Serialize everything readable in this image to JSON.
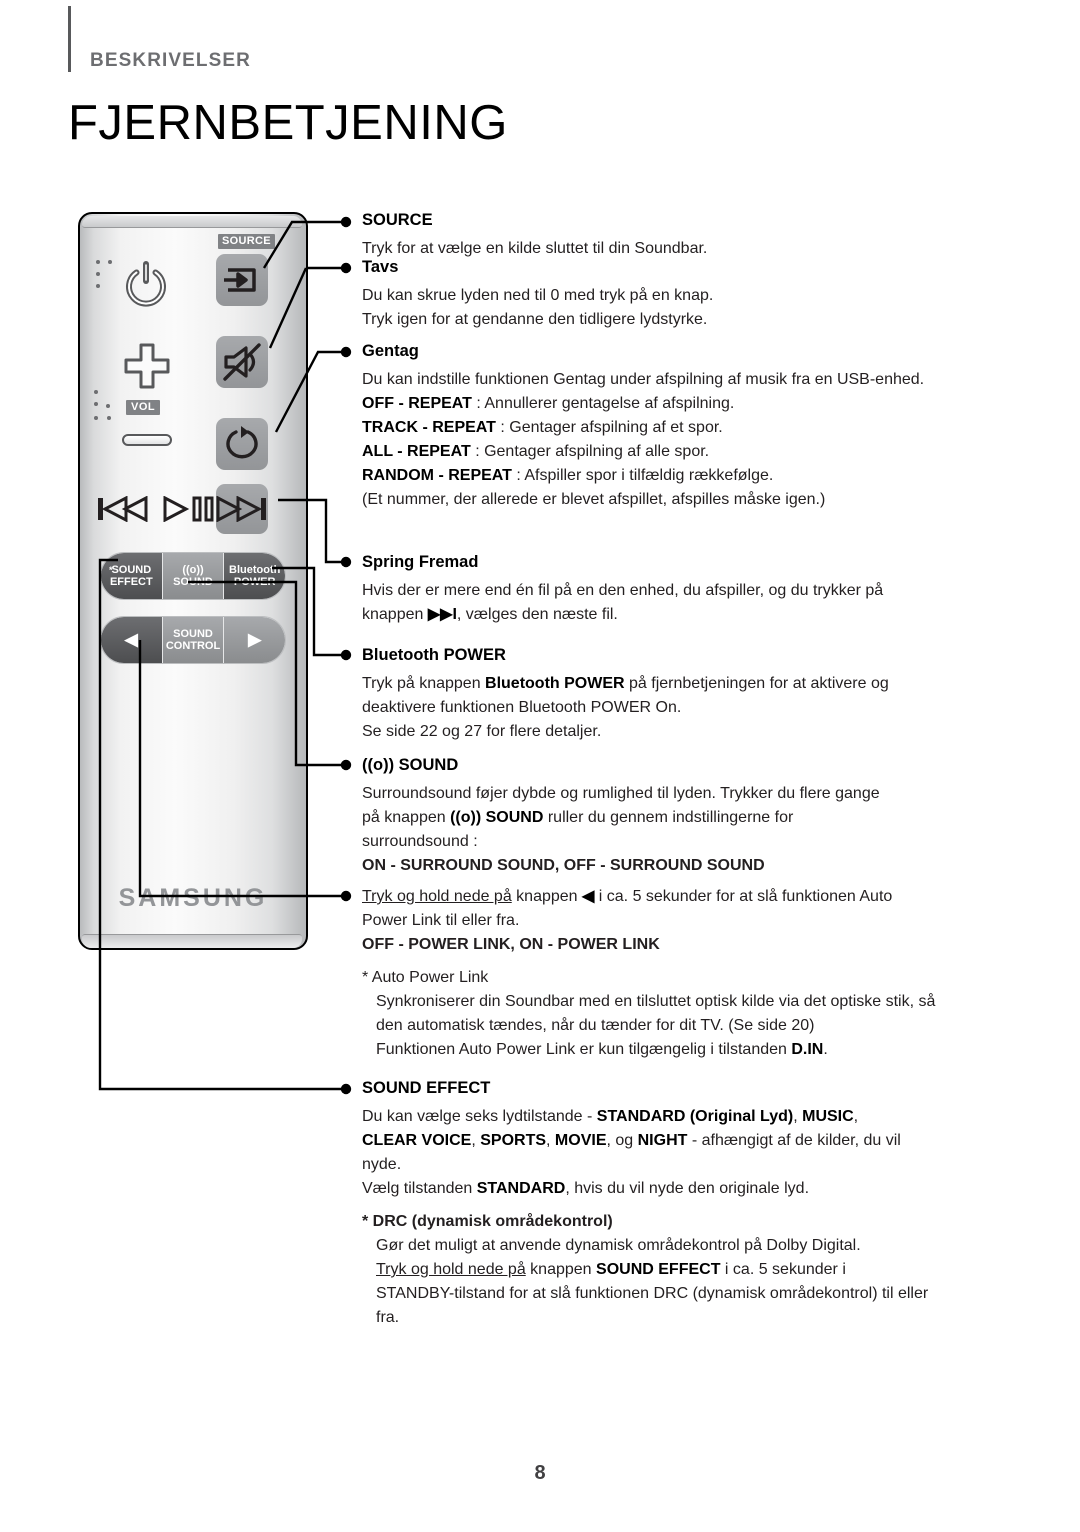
{
  "header": {
    "section_label": "BESKRIVELSER",
    "title": "FJERNBETJENING"
  },
  "remote": {
    "brand": "SAMSUNG",
    "source_chip": "SOURCE",
    "vol_chip": "VOL",
    "pill_row_1": [
      {
        "line1": "SOUND",
        "line2": "EFFECT",
        "star": "*",
        "name": "sound-effect-button"
      },
      {
        "line1": "((o))",
        "line2": "SOUND",
        "star": "",
        "name": "surround-sound-button"
      },
      {
        "line1": "Bluetooth",
        "line2": "POWER",
        "star": "",
        "name": "bluetooth-power-button"
      }
    ],
    "pill_row_2": [
      {
        "line1": "◀",
        "line2": "",
        "star": "",
        "name": "sound-control-left-button"
      },
      {
        "line1": "SOUND",
        "line2": "CONTROL",
        "star": "",
        "name": "sound-control-label"
      },
      {
        "line1": "▶",
        "line2": "",
        "star": "",
        "name": "sound-control-right-button"
      }
    ],
    "icons": {
      "power": "power-icon",
      "vol_plus": "volume-up-icon",
      "vol_minus": "volume-down-icon",
      "source": "source-input-icon",
      "mute": "mute-icon",
      "repeat": "repeat-icon",
      "prev": "previous-track-icon",
      "play_pause": "play-pause-icon",
      "next": "next-track-icon"
    }
  },
  "entries": {
    "source": {
      "title": "SOURCE",
      "body_1": "Tryk for at vælge en kilde sluttet til din Soundbar."
    },
    "mute": {
      "title": "Tavs",
      "body_1": "Du kan skrue lyden ned til 0 med tryk på en knap.",
      "body_2": "Tryk igen for at gendanne den tidligere lydstyrke."
    },
    "repeat": {
      "title": "Gentag",
      "body_1": "Du kan indstille funktionen Gentag under afspilning af musik fra en USB-enhed.",
      "off_label": "OFF - REPEAT",
      "off_text": " : Annullerer gentagelse af afspilning.",
      "track_label": "TRACK - REPEAT",
      "track_text": " : Gentager afspilning af et spor.",
      "all_label": "ALL - REPEAT",
      "all_text": " : Gentager afspilning af alle spor.",
      "random_label": "RANDOM - REPEAT",
      "random_text": " : Afspiller spor i tilfældig rækkefølge.",
      "random_note": "(Et nummer, der allerede er blevet afspillet, afspilles måske igen.)"
    },
    "skip_forward": {
      "title": "Spring Fremad",
      "body_1": "Hvis der er mere end én fil på en den enhed, du afspiller, og du trykker på",
      "body_2_pre": "knappen ",
      "body_2_icon": "▶▶I",
      "body_2_post": ", vælges den næste fil."
    },
    "bluetooth_power": {
      "title": "Bluetooth POWER",
      "body_1_pre": "Tryk på knappen ",
      "body_1_bold": "Bluetooth POWER",
      "body_1_post": " på fjernbetjeningen for at aktivere og",
      "body_2": "deaktivere funktionen Bluetooth POWER On.",
      "body_3": "Se side 22 og 27 for flere detaljer."
    },
    "surround_sound": {
      "title_icon": "((o))",
      "title": " SOUND",
      "body_1": "Surroundsound føjer dybde og rumlighed til lyden. Trykker du flere gange",
      "body_2_pre": "på knappen ",
      "body_2_icon": "((o)) SOUND",
      "body_2_post": " ruller du gennem indstillingerne for",
      "body_3": "surroundsound :",
      "modes": "ON - SURROUND SOUND, OFF - SURROUND SOUND"
    },
    "auto_power_link": {
      "line_1_underline": "Tryk og hold nede på",
      "line_1_pre": " knappen ",
      "line_1_icon": "◀",
      "line_1_post": " i ca. 5 sekunder for at slå funktionen Auto",
      "line_2": "Power Link til eller fra.",
      "modes": "OFF - POWER LINK, ON - POWER LINK",
      "note_title": "* Auto Power Link",
      "note_1": "Synkroniserer din Soundbar med en tilsluttet optisk kilde via det optiske stik, så",
      "note_2": "den automatisk tændes, når du tænder for dit TV. (Se side 20)",
      "note_3_pre": "Funktionen Auto Power Link er kun tilgængelig i tilstanden ",
      "note_3_bold": "D.IN",
      "note_3_post": "."
    },
    "sound_effect": {
      "title": "SOUND EFFECT",
      "body_1_pre": "Du kan vælge seks lydtilstande - ",
      "body_1_b1": "STANDARD (Original Lyd)",
      "body_1_mid": ", ",
      "body_1_b2": "MUSIC",
      "body_1_post": ",",
      "body_2_b1": "CLEAR VOICE",
      "body_2_s1": ", ",
      "body_2_b2": "SPORTS",
      "body_2_s2": ", ",
      "body_2_b3": "MOVIE",
      "body_2_s3": ", og ",
      "body_2_b4": "NIGHT",
      "body_2_post": " - afhængigt af de kilder, du vil",
      "body_3": "nyde.",
      "body_4_pre": "Vælg tilstanden ",
      "body_4_bold": "STANDARD",
      "body_4_post": ", hvis du vil nyde den originale lyd.",
      "drc_title": "* DRC (dynamisk områdekontrol)",
      "drc_1": "Gør det muligt at anvende dynamisk områdekontrol på Dolby Digital.",
      "drc_2_underline": "Tryk og hold nede på",
      "drc_2_pre": " knappen ",
      "drc_2_bold": "SOUND EFFECT",
      "drc_2_post": " i ca. 5 sekunder i",
      "drc_3": "STANDBY-tilstand for at slå funktionen DRC (dynamisk områdekontrol) til eller",
      "drc_4": "fra."
    }
  },
  "page_number": "8",
  "colors": {
    "text": "#231f20",
    "label_gray": "#6d6e71",
    "chip_gray": "#808285",
    "rule": "#58595b"
  }
}
